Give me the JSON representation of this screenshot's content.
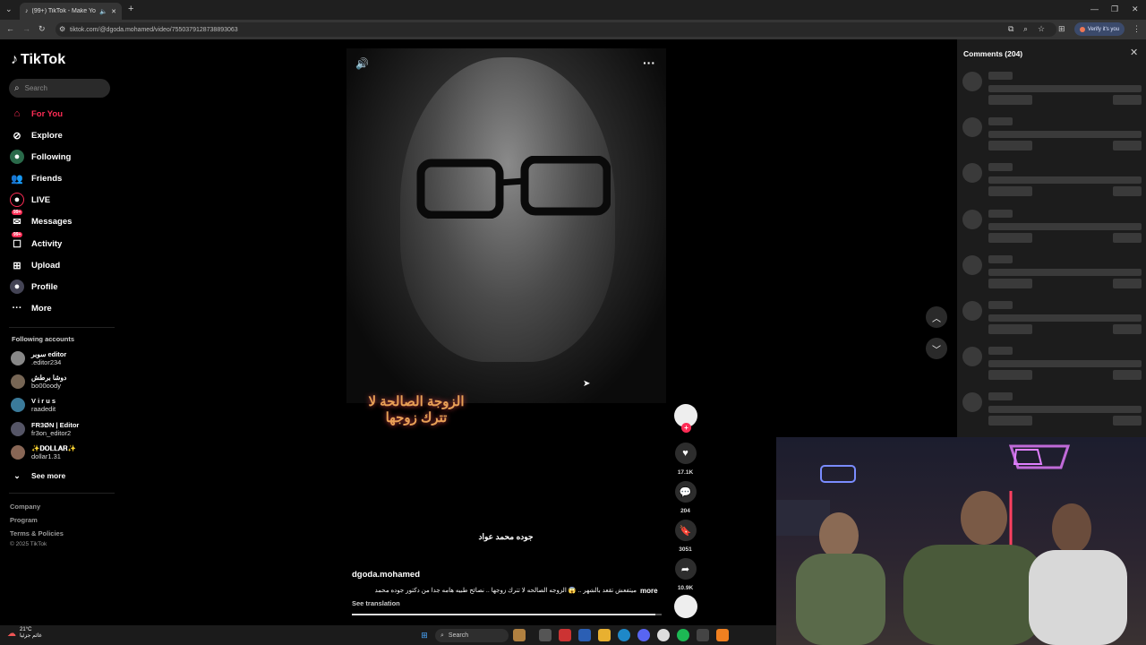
{
  "browser": {
    "tab_title": "(99+) TikTok - Make Your D...",
    "url": "tiktok.com/@dgoda.mohamed/video/7550379128738893063",
    "verify_label": "Verify it's you"
  },
  "sidebar": {
    "logo": "TikTok",
    "search_placeholder": "Search",
    "items": [
      {
        "label": "For You",
        "icon": "home-icon"
      },
      {
        "label": "Explore",
        "icon": "compass-icon"
      },
      {
        "label": "Following",
        "icon": "following-icon"
      },
      {
        "label": "Friends",
        "icon": "friends-icon"
      },
      {
        "label": "LIVE",
        "icon": "live-icon"
      },
      {
        "label": "Messages",
        "icon": "messages-icon",
        "badge": "99+"
      },
      {
        "label": "Activity",
        "icon": "activity-icon",
        "badge": "99+"
      },
      {
        "label": "Upload",
        "icon": "upload-icon"
      },
      {
        "label": "Profile",
        "icon": "profile-icon"
      },
      {
        "label": "More",
        "icon": "more-icon"
      }
    ],
    "following_title": "Following accounts",
    "accounts": [
      {
        "name": "سوبر editor",
        "user": ".editor234"
      },
      {
        "name": "دوشا برطش",
        "user": "bo00oody"
      },
      {
        "name": "V i r u s",
        "user": "raadedit"
      },
      {
        "name": "FR3ØN | Editor",
        "user": "fr3on_editor2"
      },
      {
        "name": "✨𝐃𝐎𝐋𝐋𝐀𝐑✨",
        "user": "dollar1.31"
      }
    ],
    "see_more": "See more",
    "footer": [
      "Company",
      "Program",
      "Terms & Policies",
      "© 2025 TikTok"
    ]
  },
  "video": {
    "overlay_caption": "الزوجة الصالحة لا تترك زوجها",
    "subtitle": "جوده محمد عواد",
    "author": "dgoda.mohamed",
    "description": "ميتفعش تقعد بالشهر .. 😱 الزوجه الصالحه لا تترك زوجها .. نصائح طبيه هامه جدا من دكتور جوده محمد",
    "more_label": "more",
    "see_translation": "See translation",
    "progress": 0.98
  },
  "actions": {
    "likes": "17.1K",
    "comments": "204",
    "saves": "3051",
    "shares": "10.9K"
  },
  "comments_panel": {
    "title": "Comments (204)"
  },
  "taskbar": {
    "temp": "21°C",
    "weather_text": "غائم جزئيا",
    "search_label": "Search"
  }
}
